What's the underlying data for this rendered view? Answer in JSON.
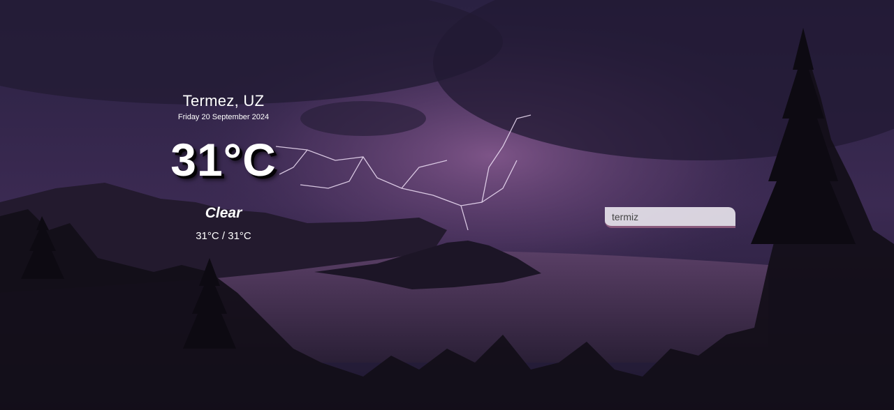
{
  "location": {
    "city": "Termez, UZ",
    "date": "Friday 20 September 2024"
  },
  "current": {
    "temperature": "31°C",
    "condition": "Clear",
    "hi_low": "31°C / 31°C"
  },
  "search": {
    "value": "termiz"
  },
  "colors": {
    "sky_top": "#2d2245",
    "sky_glow": "#6e4a7e",
    "water": "#3e2c4e",
    "text": "#ffffff",
    "search_bg": "#e6e2ea",
    "search_border": "#8a5a7c"
  }
}
